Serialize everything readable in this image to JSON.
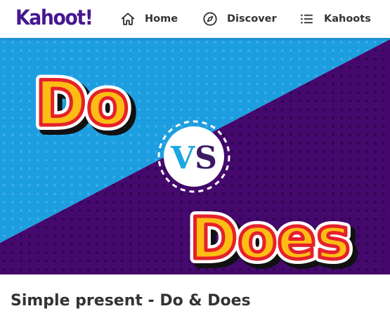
{
  "brand": {
    "logo_text": "Kahoot!",
    "color": "#46178f"
  },
  "nav": {
    "items": [
      {
        "label": "Home",
        "icon": "home-icon"
      },
      {
        "label": "Discover",
        "icon": "compass-icon"
      },
      {
        "label": "Kahoots",
        "icon": "list-icon"
      }
    ]
  },
  "hero": {
    "word_top": "Do",
    "word_vs": "VS",
    "word_bottom": "Does",
    "colors": {
      "blue": "#1d9ee0",
      "purple": "#45096e",
      "word_fill": "#fdbd14",
      "word_outline": "#e5212a",
      "vs_v": "#1ca7e1",
      "vs_s": "#3b1a63"
    }
  },
  "kahoot": {
    "title": "Simple present - Do & Does"
  }
}
